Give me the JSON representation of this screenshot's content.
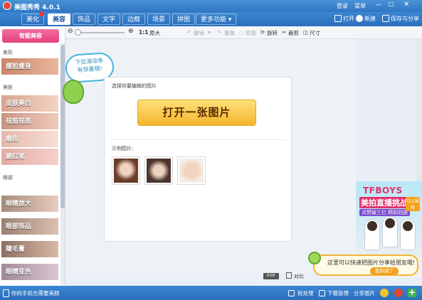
{
  "app": {
    "title": "美图秀秀 4.0.1"
  },
  "titlebar": {
    "login": "登录",
    "menu": "菜单"
  },
  "tabs": [
    "美化",
    "美容",
    "饰品",
    "文字",
    "边框",
    "场景",
    "拼图",
    "更多功能"
  ],
  "active_tab": "美容",
  "right_actions": {
    "open": "打开",
    "new": "新建",
    "save_share": "保存与分享"
  },
  "toolbar": {
    "zoom_ratio": "1:1",
    "original_size": "原大",
    "undo": "撤销",
    "redo": "重做",
    "original_image": "原图",
    "rotate": "旋转",
    "crop": "裁剪",
    "size": "尺寸"
  },
  "sidebar": {
    "smart_button": "智能美容",
    "sections": [
      {
        "title": "美形",
        "items": [
          "瘦脸瘦身"
        ]
      },
      {
        "title": "美肤",
        "items": [
          "皮肤美白",
          "祛痘祛斑",
          "磨皮",
          "腮红笔"
        ]
      },
      {
        "title": "眼部",
        "items": [
          "眼睛放大",
          "眼部饰品",
          "睫毛膏",
          "眼睛变色"
        ]
      }
    ]
  },
  "mascot": {
    "hint": "下拉滚动条\n有惊喜哦!"
  },
  "main": {
    "pick_label": "选择你要编辑的图片",
    "open_button": "打开一张图片",
    "sample_label": "示例图片:"
  },
  "ad": {
    "title": "TFBOYS",
    "subtitle": "美拍直播挑战",
    "line": "点赞破三亿 精彩回放",
    "badge": "马上围观"
  },
  "tip": {
    "text": "这里可以快速把图片分享给朋友哦!",
    "button": "我知道了"
  },
  "exif_label": "EXIF",
  "compare_label": "对比",
  "statusbar": {
    "phone": "你的手机也需要美颜",
    "batch": "批处理",
    "downloads": "下载管理",
    "share": "分享图片"
  },
  "colors": {
    "brand_blue": "#2f77c4",
    "accent_pink": "#e4407c",
    "button_yellow": "#f4b62c"
  }
}
